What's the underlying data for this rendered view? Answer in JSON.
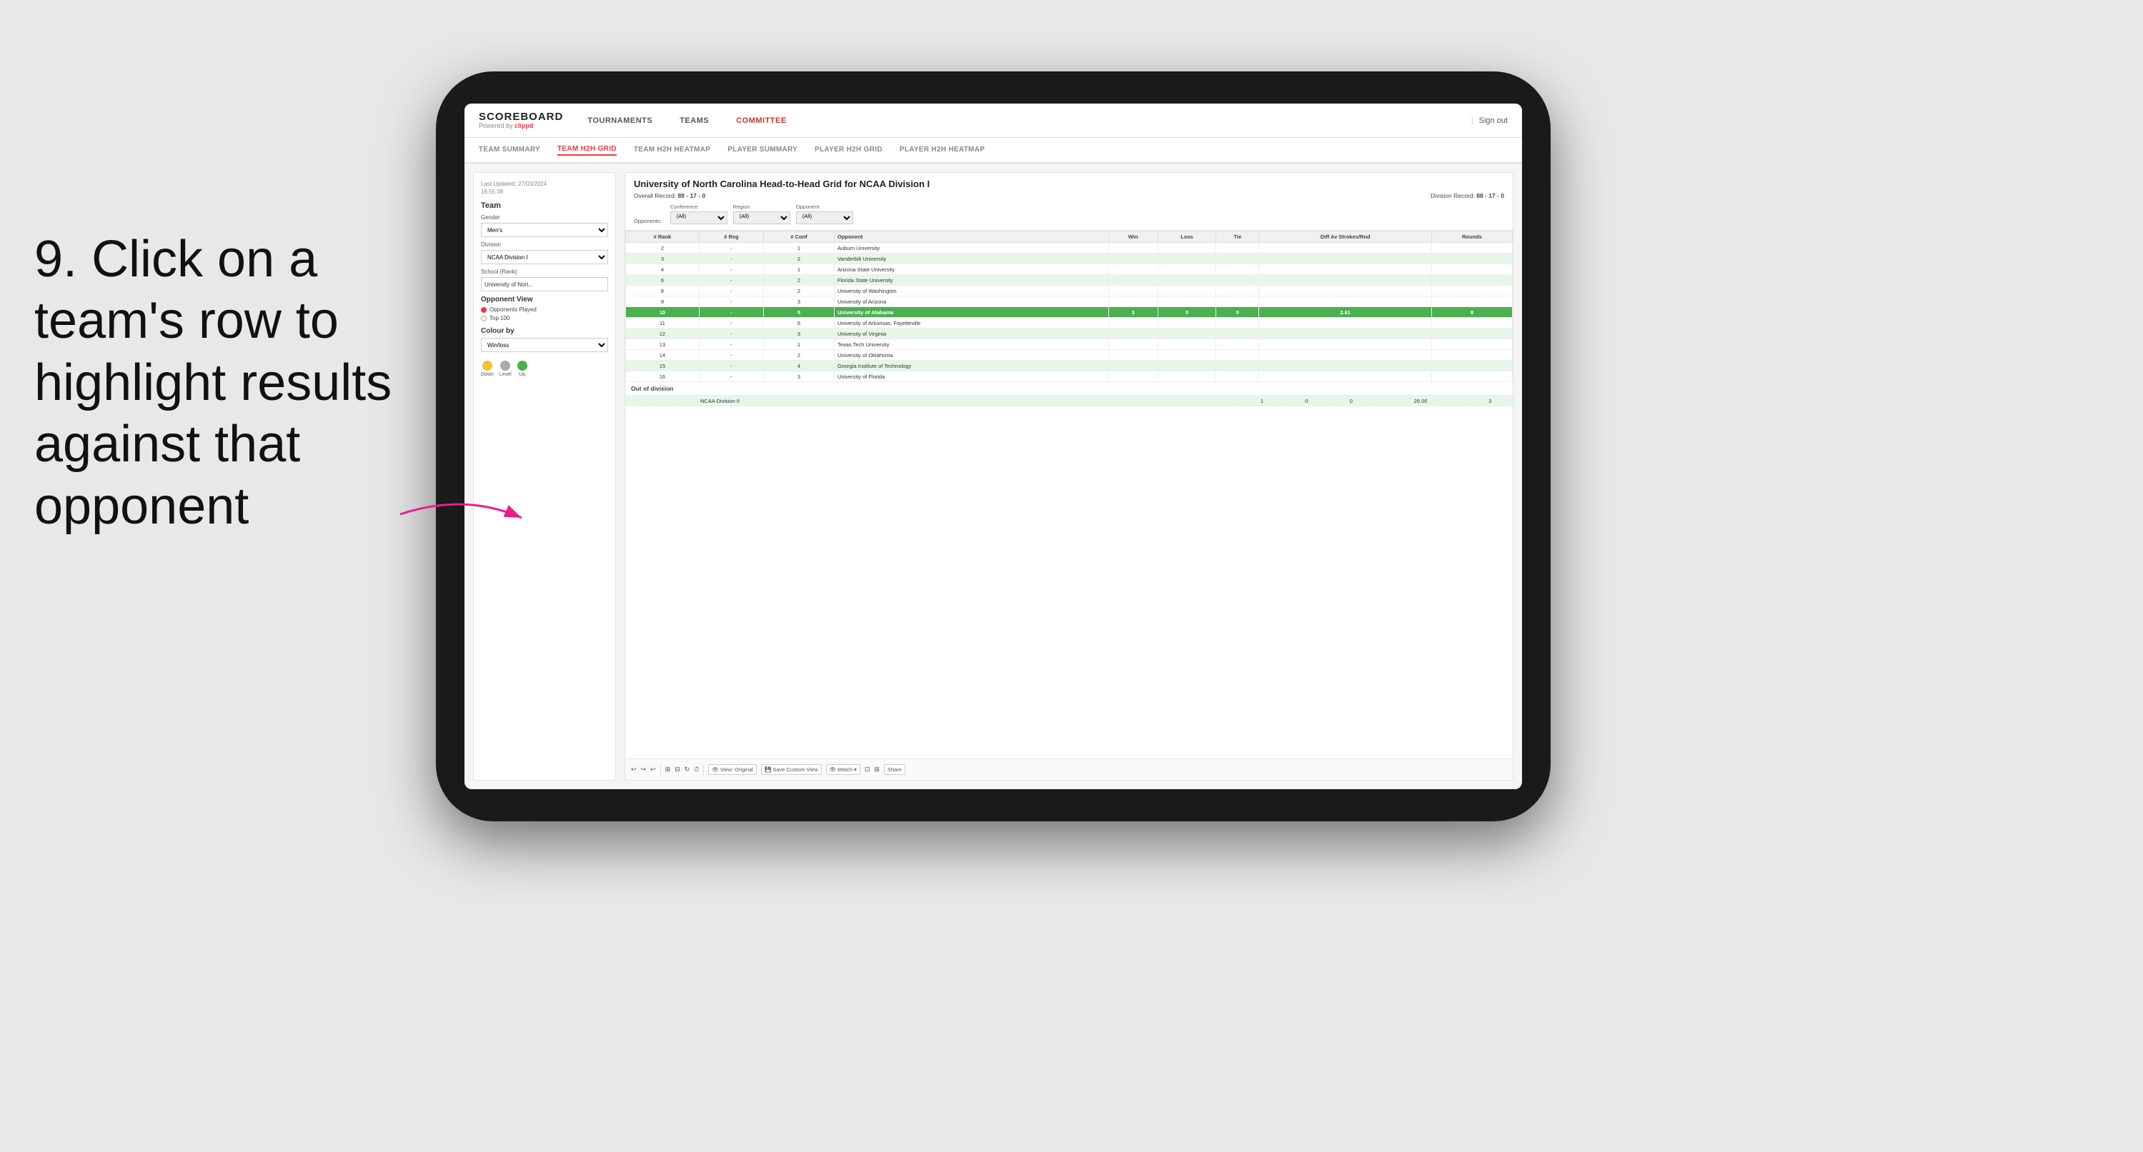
{
  "instruction": {
    "number": "9.",
    "text": "Click on a team's row to highlight results against that opponent"
  },
  "nav": {
    "logo": "SCOREBOARD",
    "powered_by": "Powered by",
    "brand": "clippd",
    "items": [
      "TOURNAMENTS",
      "TEAMS",
      "COMMITTEE"
    ],
    "active_item": "COMMITTEE",
    "sign_out": "Sign out"
  },
  "sub_nav": {
    "items": [
      "TEAM SUMMARY",
      "TEAM H2H GRID",
      "TEAM H2H HEATMAP",
      "PLAYER SUMMARY",
      "PLAYER H2H GRID",
      "PLAYER H2H HEATMAP"
    ],
    "active_item": "TEAM H2H GRID"
  },
  "left_panel": {
    "last_updated_label": "Last Updated: 27/03/2024",
    "last_updated_time": "16:55:38",
    "team_label": "Team",
    "gender_label": "Gender",
    "gender_value": "Men's",
    "division_label": "Division",
    "division_value": "NCAA Division I",
    "school_label": "School (Rank)",
    "school_value": "University of Nort...",
    "opponent_view_label": "Opponent View",
    "radio_options": [
      "Opponents Played",
      "Top 100"
    ],
    "selected_radio": "Opponents Played",
    "colour_by_label": "Colour by",
    "colour_by_value": "Win/loss",
    "legend": [
      {
        "label": "Down",
        "color": "#f4c430"
      },
      {
        "label": "Level",
        "color": "#aaaaaa"
      },
      {
        "label": "Up",
        "color": "#4CAF50"
      }
    ]
  },
  "grid": {
    "title": "University of North Carolina Head-to-Head Grid for NCAA Division I",
    "overall_record_label": "Overall Record:",
    "overall_record": "89 - 17 - 0",
    "division_record_label": "Division Record:",
    "division_record": "88 - 17 - 0",
    "filter_labels": {
      "conference": "Conference",
      "region": "Region",
      "opponent": "Opponent",
      "opponents": "Opponents:"
    },
    "filter_values": {
      "conference": "(All)",
      "region": "(All)",
      "opponent": "(All)"
    },
    "columns": [
      "# Rank",
      "# Reg",
      "# Conf",
      "Opponent",
      "Win",
      "Loss",
      "Tie",
      "Diff Av Strokes/Rnd",
      "Rounds"
    ],
    "rows": [
      {
        "rank": "2",
        "reg": "-",
        "conf": "1",
        "opponent": "Auburn University",
        "win": "",
        "loss": "",
        "tie": "",
        "diff": "",
        "rounds": "",
        "row_class": ""
      },
      {
        "rank": "3",
        "reg": "-",
        "conf": "2",
        "opponent": "Vanderbilt University",
        "win": "",
        "loss": "",
        "tie": "",
        "diff": "",
        "rounds": "",
        "row_class": "light-green"
      },
      {
        "rank": "4",
        "reg": "-",
        "conf": "1",
        "opponent": "Arizona State University",
        "win": "",
        "loss": "",
        "tie": "",
        "diff": "",
        "rounds": "",
        "row_class": ""
      },
      {
        "rank": "6",
        "reg": "-",
        "conf": "2",
        "opponent": "Florida State University",
        "win": "",
        "loss": "",
        "tie": "",
        "diff": "",
        "rounds": "",
        "row_class": "light-green"
      },
      {
        "rank": "8",
        "reg": "-",
        "conf": "2",
        "opponent": "University of Washington",
        "win": "",
        "loss": "",
        "tie": "",
        "diff": "",
        "rounds": "",
        "row_class": ""
      },
      {
        "rank": "9",
        "reg": "-",
        "conf": "3",
        "opponent": "University of Arizona",
        "win": "",
        "loss": "",
        "tie": "",
        "diff": "",
        "rounds": "",
        "row_class": ""
      },
      {
        "rank": "10",
        "reg": "-",
        "conf": "5",
        "opponent": "University of Alabama",
        "win": "3",
        "loss": "0",
        "tie": "0",
        "diff": "2.61",
        "rounds": "8",
        "row_class": "highlighted"
      },
      {
        "rank": "11",
        "reg": "-",
        "conf": "6",
        "opponent": "University of Arkansas, Fayetteville",
        "win": "",
        "loss": "",
        "tie": "",
        "diff": "",
        "rounds": "",
        "row_class": ""
      },
      {
        "rank": "12",
        "reg": "-",
        "conf": "3",
        "opponent": "University of Virginia",
        "win": "",
        "loss": "",
        "tie": "",
        "diff": "",
        "rounds": "",
        "row_class": "light-green"
      },
      {
        "rank": "13",
        "reg": "-",
        "conf": "1",
        "opponent": "Texas Tech University",
        "win": "",
        "loss": "",
        "tie": "",
        "diff": "",
        "rounds": "",
        "row_class": ""
      },
      {
        "rank": "14",
        "reg": "-",
        "conf": "2",
        "opponent": "University of Oklahoma",
        "win": "",
        "loss": "",
        "tie": "",
        "diff": "",
        "rounds": "",
        "row_class": ""
      },
      {
        "rank": "15",
        "reg": "-",
        "conf": "4",
        "opponent": "Georgia Institute of Technology",
        "win": "",
        "loss": "",
        "tie": "",
        "diff": "",
        "rounds": "",
        "row_class": "light-green"
      },
      {
        "rank": "16",
        "reg": "-",
        "conf": "3",
        "opponent": "University of Florida",
        "win": "",
        "loss": "",
        "tie": "",
        "diff": "",
        "rounds": "",
        "row_class": ""
      }
    ],
    "out_of_division_label": "Out of division",
    "out_of_division_row": {
      "label": "NCAA Division II",
      "win": "1",
      "loss": "0",
      "tie": "0",
      "diff": "26.00",
      "rounds": "3"
    }
  },
  "toolbar": {
    "view_label": "View: Original",
    "save_label": "Save Custom View",
    "watch_label": "Watch",
    "share_label": "Share"
  }
}
